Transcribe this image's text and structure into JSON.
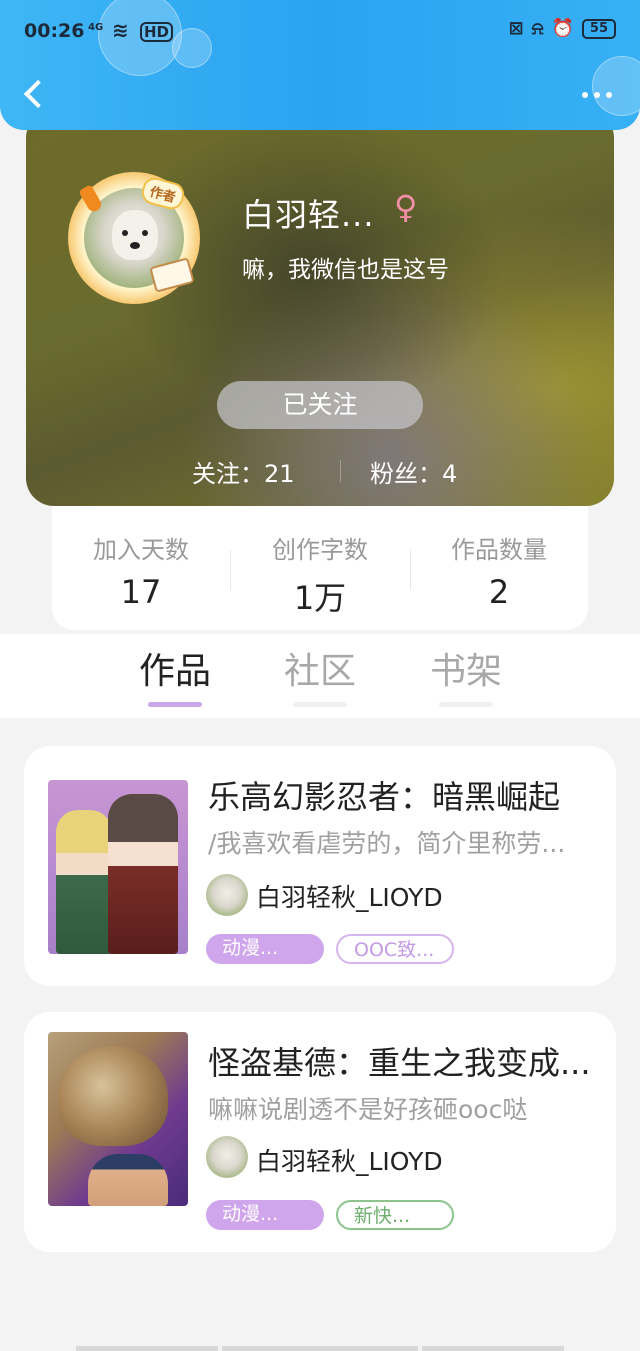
{
  "status_bar": {
    "time": "00:26",
    "signal": "4G",
    "hd": "HD",
    "battery": "55"
  },
  "profile": {
    "nickname": "白羽轻...",
    "gender_symbol": "♀",
    "author_badge": "作者",
    "signature": "嘛，我微信也是这号",
    "follow_button_label": "已关注",
    "following_text": "关注：21",
    "fans_text": "粉丝：4"
  },
  "stats": [
    {
      "label": "加入天数",
      "value": "17"
    },
    {
      "label": "创作字数",
      "value": "1万"
    },
    {
      "label": "作品数量",
      "value": "2"
    }
  ],
  "tabs": [
    {
      "label": "作品",
      "active": true
    },
    {
      "label": "社区",
      "active": false
    },
    {
      "label": "书架",
      "active": false
    }
  ],
  "works": [
    {
      "title": "乐高幻影忍者：暗黑崛起",
      "description": "/我喜欢看虐劳的，简介里称劳...",
      "author": "白羽轻秋_LIOYD",
      "tags": [
        "动漫...",
        "OOC致..."
      ]
    },
    {
      "title": "怪盗基德：重生之我变成...",
      "description": "嘛嘛说剧透不是好孩砸ooc哒",
      "author": "白羽轻秋_LIOYD",
      "tags": [
        "动漫...",
        "新快..."
      ]
    }
  ],
  "colors": {
    "header_blue": "#2aa3f1",
    "tab_indicator": "#c8a6e8",
    "tag_purple": "#cfa5ec",
    "tag_green": "#6fae6f",
    "gender_pink": "#f08fa6"
  },
  "icons": [
    "back-arrow-icon",
    "more-dots-icon",
    "wifi-icon",
    "alarm-icon",
    "mute-icon",
    "female-icon",
    "book-icon",
    "carrot-icon"
  ]
}
